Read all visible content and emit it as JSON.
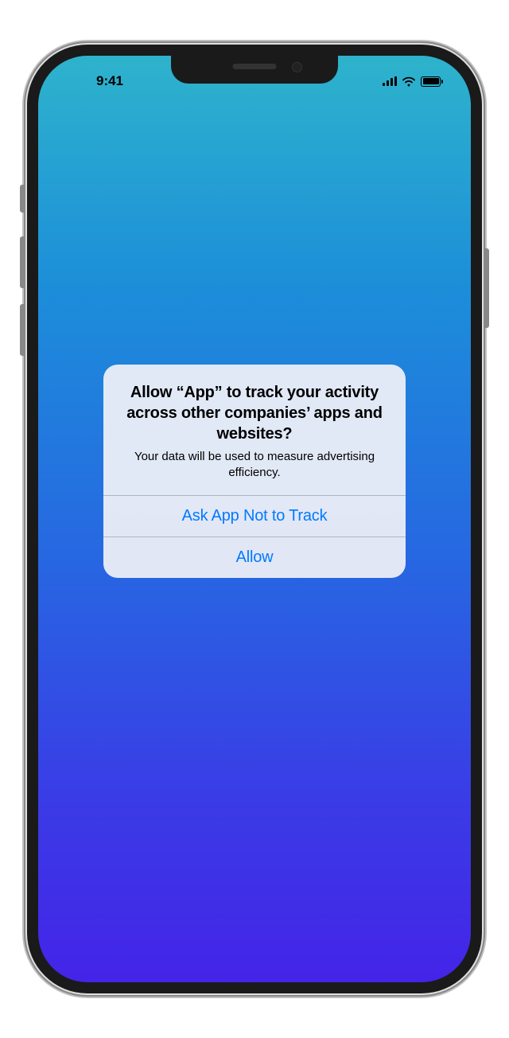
{
  "status_bar": {
    "time": "9:41"
  },
  "alert": {
    "title": "Allow “App” to track your activity across other companies’ apps and websites?",
    "message": "Your data will be used to measure advertising efficiency.",
    "deny_label": "Ask App Not to Track",
    "allow_label": "Allow"
  }
}
